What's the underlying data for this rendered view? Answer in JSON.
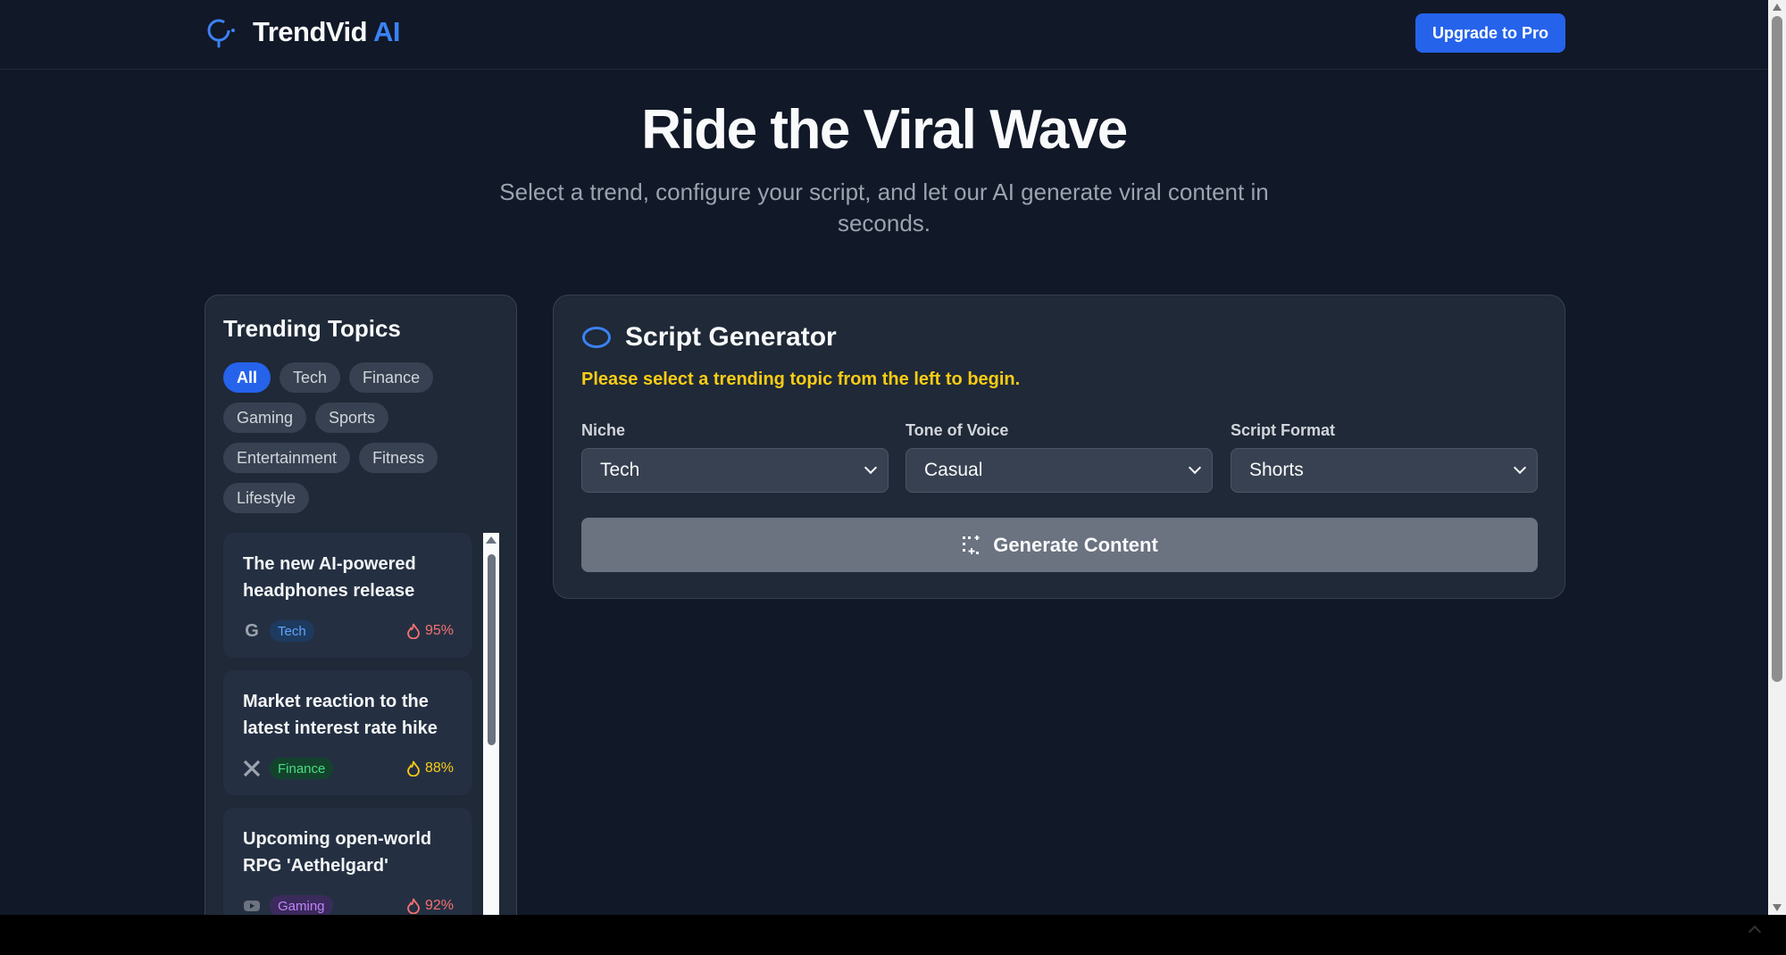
{
  "header": {
    "brand_name": "TrendVid",
    "brand_accent": "AI",
    "upgrade_label": "Upgrade to Pro"
  },
  "hero": {
    "title": "Ride the Viral Wave",
    "subtitle": "Select a trend, configure your script, and let our AI generate viral content in seconds."
  },
  "topics": {
    "title": "Trending Topics",
    "filters": [
      "All",
      "Tech",
      "Finance",
      "Gaming",
      "Sports",
      "Entertainment",
      "Fitness",
      "Lifestyle"
    ],
    "active_filter": "All",
    "items": [
      {
        "title": "The new AI-powered headphones release",
        "source_icon": "google-icon",
        "tag": "Tech",
        "score": "95%"
      },
      {
        "title": "Market reaction to the latest interest rate hike",
        "source_icon": "x-icon",
        "tag": "Finance",
        "score": "88%"
      },
      {
        "title": "Upcoming open-world RPG 'Aethelgard'",
        "source_icon": "youtube-icon",
        "tag": "Gaming",
        "score": "92%"
      }
    ]
  },
  "generator": {
    "title": "Script Generator",
    "warning": "Please select a trending topic from the left to begin.",
    "fields": [
      {
        "label": "Niche",
        "value": "Tech"
      },
      {
        "label": "Tone of Voice",
        "value": "Casual"
      },
      {
        "label": "Script Format",
        "value": "Shorts"
      }
    ],
    "generate_label": "Generate Content"
  },
  "colors": {
    "background": "#111827",
    "panel": "#1f2937",
    "accent": "#2563eb",
    "warning": "#facc15"
  }
}
